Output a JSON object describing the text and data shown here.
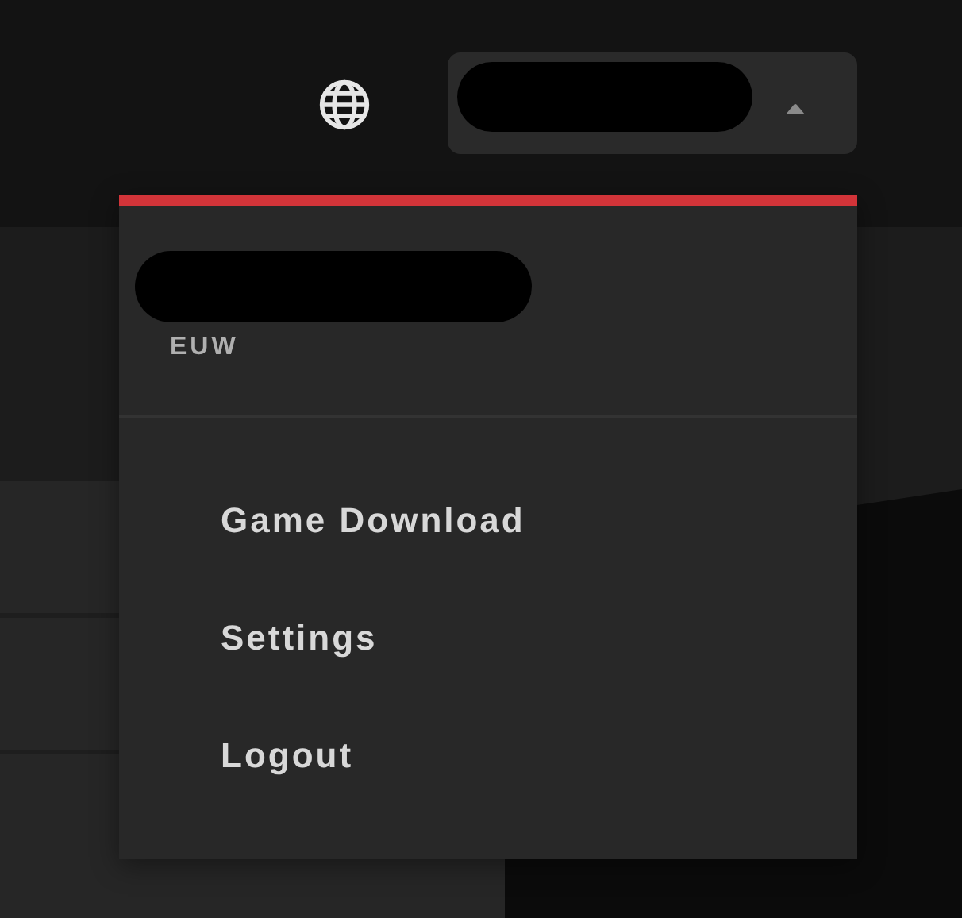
{
  "header": {
    "account_button": {
      "expanded": true
    }
  },
  "dropdown": {
    "region": "EUW",
    "items": [
      {
        "label": "Game Download"
      },
      {
        "label": "Settings"
      },
      {
        "label": "Logout"
      }
    ]
  }
}
